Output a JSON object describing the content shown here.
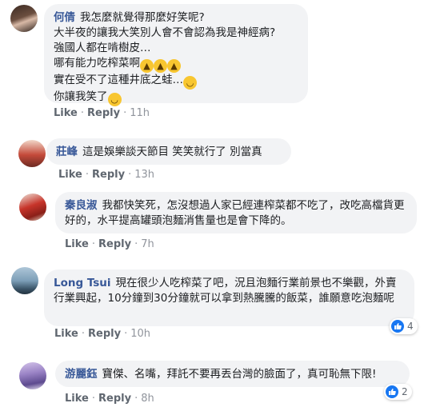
{
  "actions": {
    "like": "Like",
    "reply": "Reply"
  },
  "comments": [
    {
      "author": "何倩",
      "lines": [
        "我怎麼就覺得那麼好笑呢?",
        "大半夜的讓我大笑別人會不會認為我是神經病?",
        "強國人都在啃樹皮…",
        "哪有能力吃榨菜啊",
        "實在受不了這種井底之蛙…",
        "你讓我笑了"
      ],
      "time": "11h"
    },
    {
      "author": "莊峰",
      "text": "這是娛樂談天節目 笑笑就行了 別當真",
      "time": "13h"
    },
    {
      "author": "秦良淑",
      "text": "我都快笑死，怎沒想過人家已經連榨菜都不吃了，改吃高檔貨更好的，水平提高罐頭泡麵消售量也是會下降的。",
      "time": "7h"
    },
    {
      "author": "Long Tsui",
      "text": "現在很少人吃榨菜了吧，況且泡麵行業前景也不樂觀，外賣行業興起，10分鐘到30分鐘就可以拿到熱騰騰的飯菜，誰願意吃泡麵呢",
      "time": "10h",
      "reactions": "4"
    },
    {
      "author": "游麗鈺",
      "text": "寶傑、名嘴，拜託不要再丟台灣的臉面了，真可恥無下限!",
      "time": "8h",
      "reactions": "2"
    }
  ],
  "colors": {
    "author": "#385898",
    "bubble": "#f2f3f5",
    "like_blue": "#1877f2"
  },
  "icons": {
    "laugh": "laughing-cat-emoji",
    "smile": "smiling-emoji",
    "reaction": "thumbs-up-icon"
  }
}
